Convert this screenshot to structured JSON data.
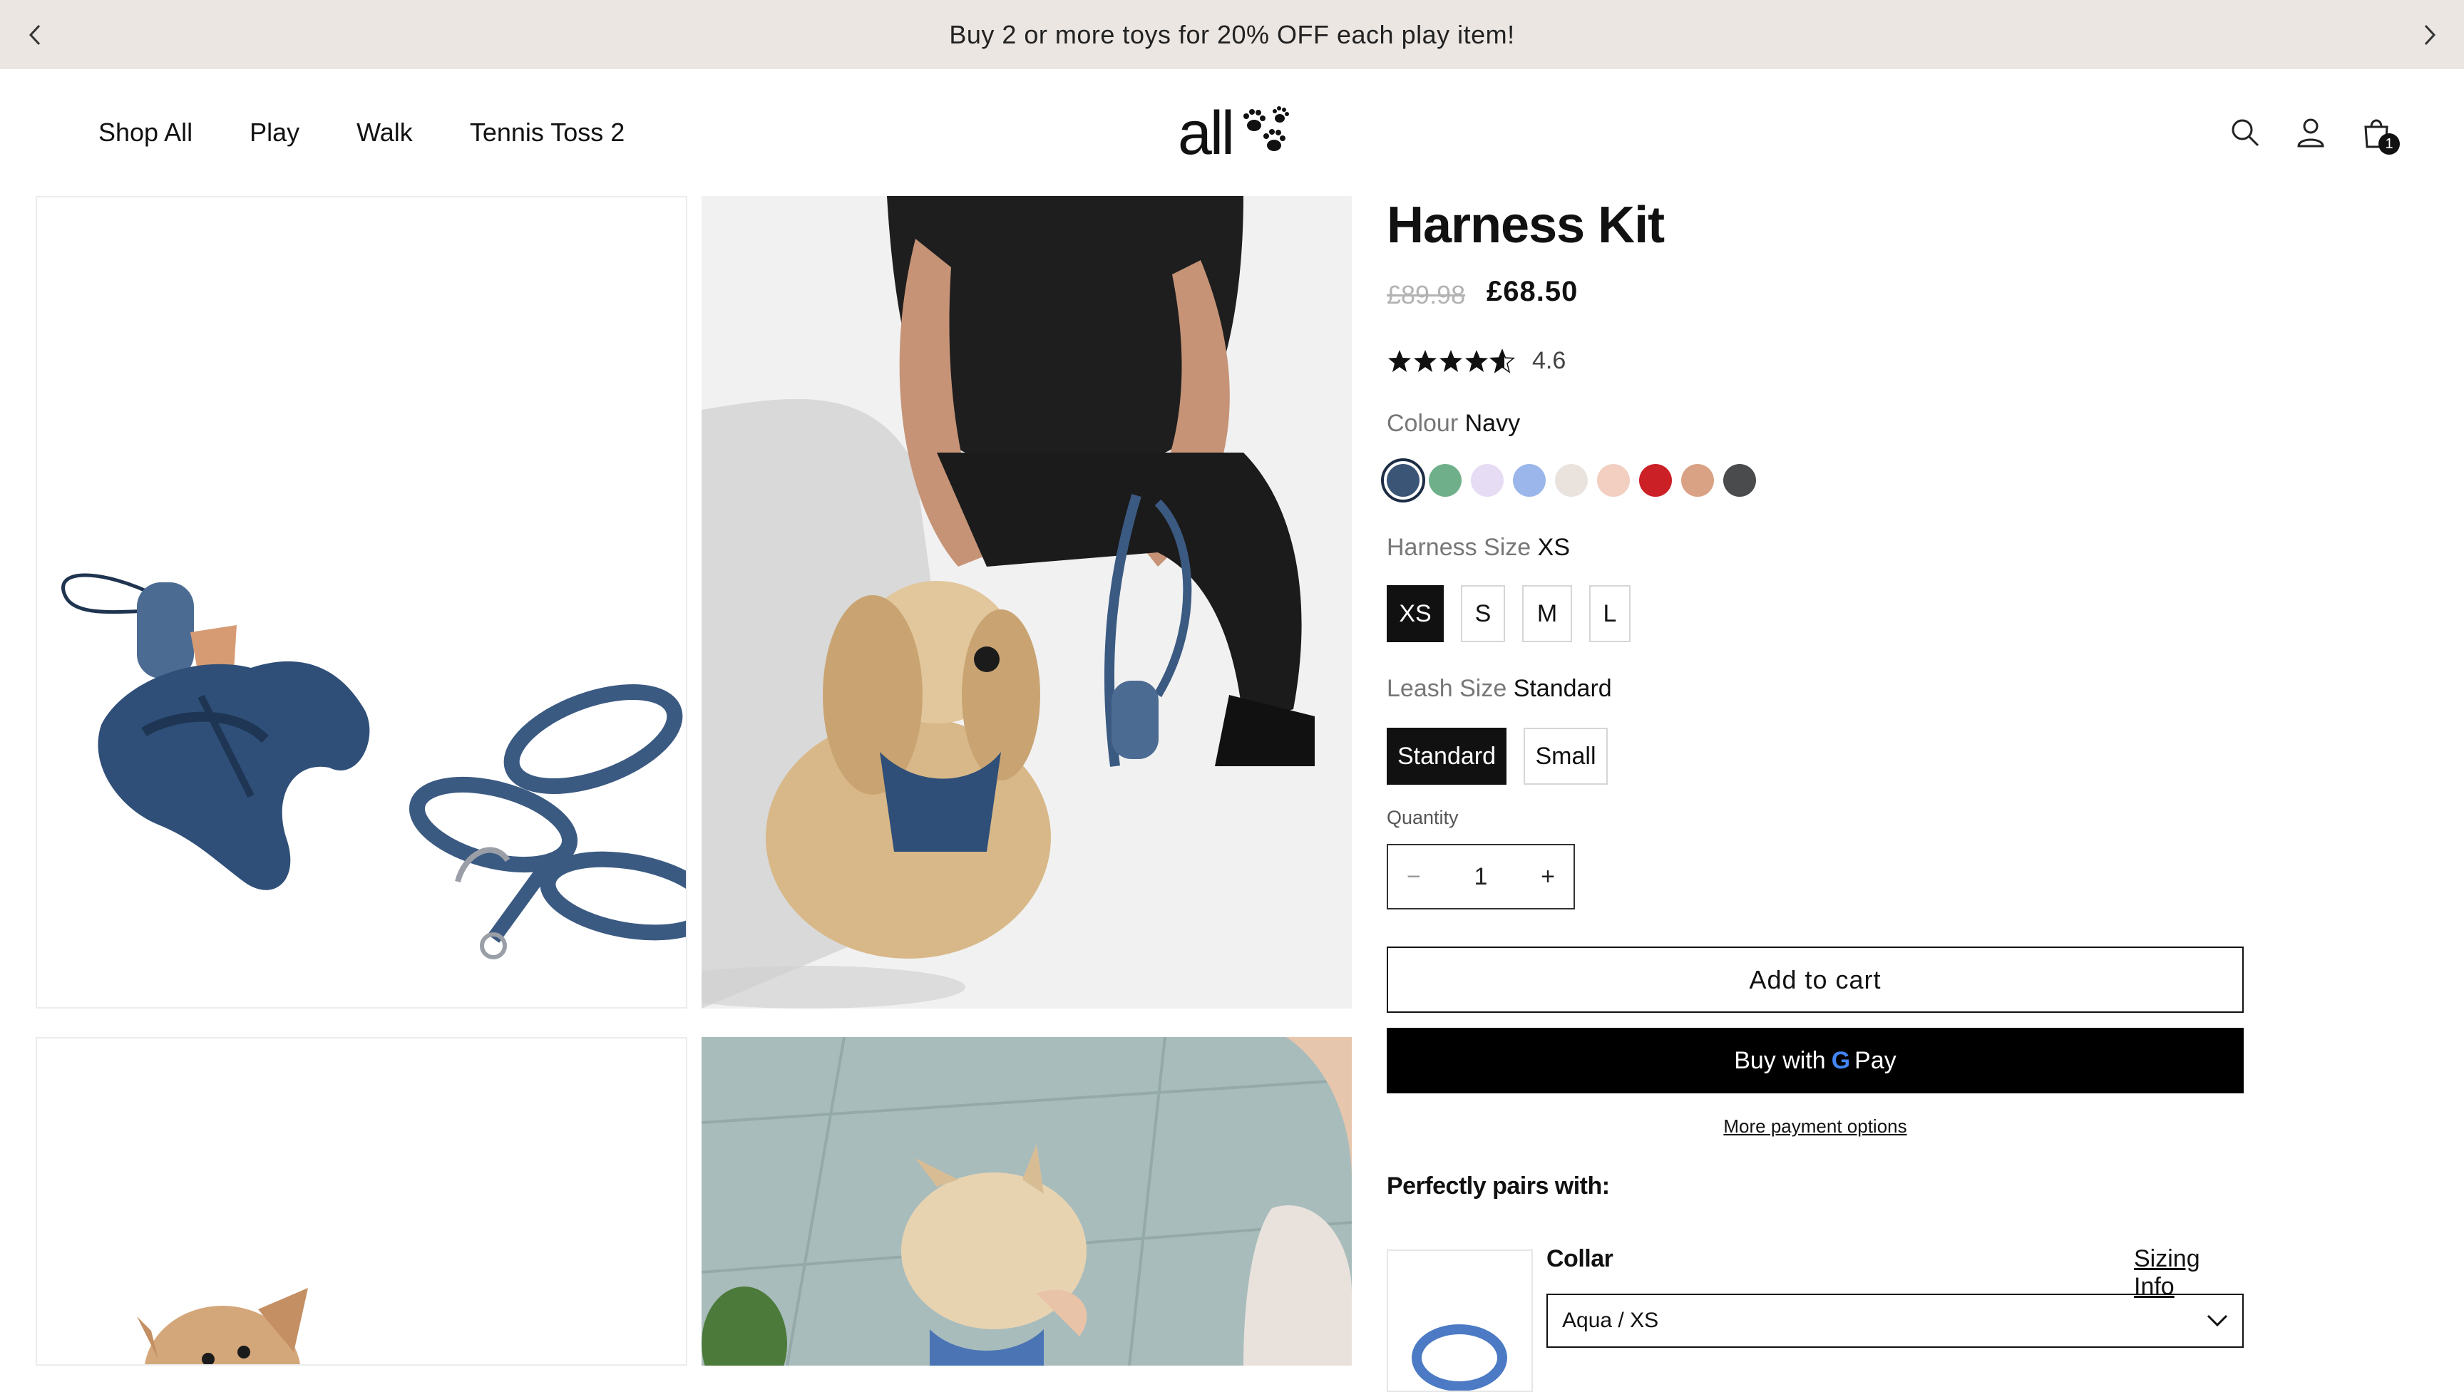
{
  "announcement": {
    "text": "Buy 2 or more toys for 20% OFF each play item!",
    "prev_icon": "chevron-left-icon",
    "next_icon": "chevron-right-icon"
  },
  "header": {
    "nav": [
      "Shop All",
      "Play",
      "Walk",
      "Tennis Toss 2"
    ],
    "logo_text": "all",
    "logo_icon": "paw-prints-icon",
    "icons": [
      "search-icon",
      "account-icon",
      "cart-icon"
    ],
    "cart_count": "1"
  },
  "product": {
    "title": "Harness Kit",
    "price_original": "£89.98",
    "price_sale": "£68.50",
    "rating": {
      "value": "4.6",
      "stars": 4.6,
      "max": 5
    },
    "colour": {
      "label": "Colour",
      "selected": "Navy",
      "swatches": [
        "#3b5577",
        "#6fb08b",
        "#e6dcf4",
        "#9ab6ea",
        "#e9e2dd",
        "#f2cfc1",
        "#cc2027",
        "#d9a285",
        "#4a4b4d"
      ]
    },
    "harness_size": {
      "label": "Harness Size",
      "selected": "XS",
      "options": [
        "XS",
        "S",
        "M",
        "L"
      ]
    },
    "leash_size": {
      "label": "Leash Size",
      "selected": "Standard",
      "options": [
        "Standard",
        "Small"
      ]
    },
    "quantity": {
      "label": "Quantity",
      "value": "1",
      "minus": "−",
      "plus": "+"
    },
    "add_to_cart": "Add to cart",
    "buy_with_pay": {
      "prefix": "Buy with",
      "g": "G",
      "suffix": "Pay"
    },
    "more_payment": "More payment options"
  },
  "pairs": {
    "heading": "Perfectly pairs with:",
    "item": {
      "name": "Collar",
      "sizing_link": "Sizing Info",
      "selected": "Aqua / XS"
    }
  },
  "colors": {
    "accent_dark": "#111111",
    "navy": "#3b5577",
    "announce_bg": "#ece6e2"
  }
}
